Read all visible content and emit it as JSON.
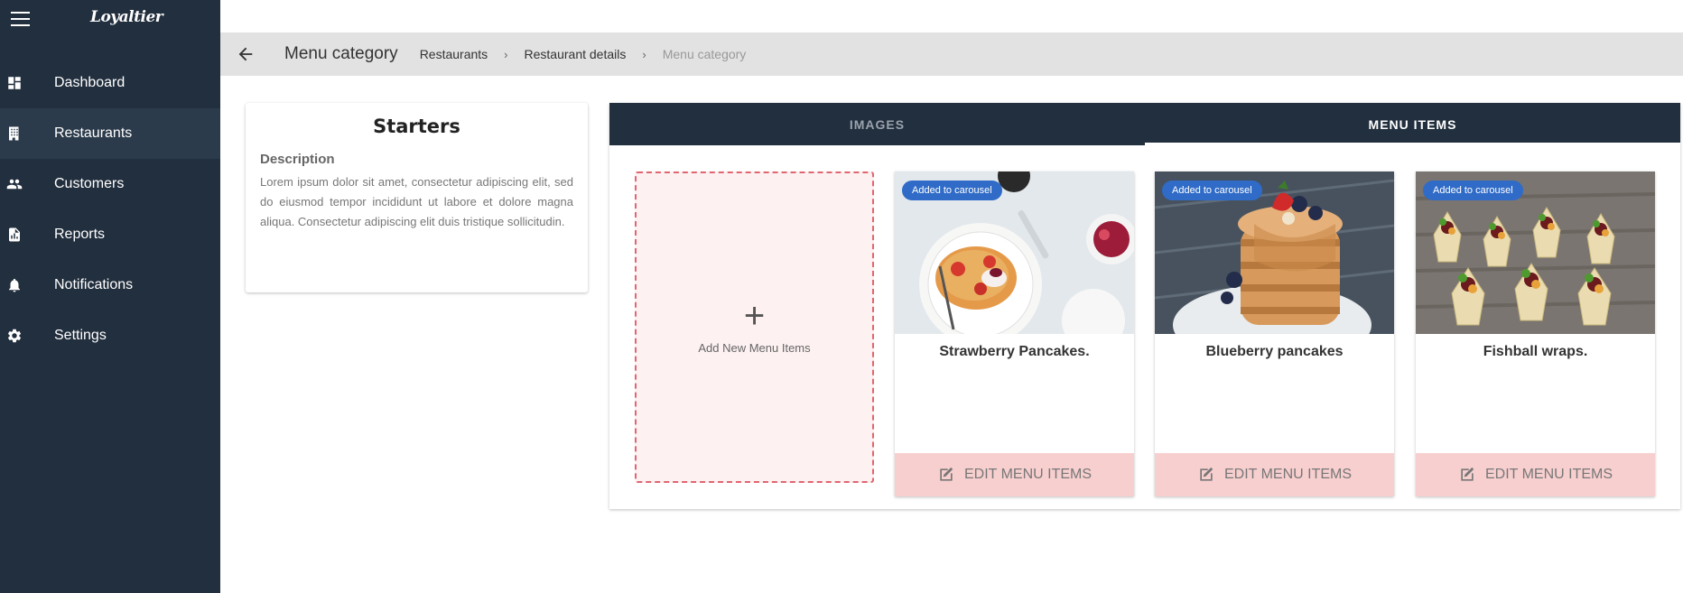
{
  "app": {
    "logo": "Loyaltier"
  },
  "sidebar": {
    "items": [
      {
        "label": "Dashboard",
        "icon": "dashboard-icon"
      },
      {
        "label": "Restaurants",
        "icon": "building-icon",
        "active": true
      },
      {
        "label": "Customers",
        "icon": "people-icon"
      },
      {
        "label": "Reports",
        "icon": "report-icon"
      },
      {
        "label": "Notifications",
        "icon": "bell-icon"
      },
      {
        "label": "Settings",
        "icon": "gear-icon"
      }
    ]
  },
  "header": {
    "title": "Menu category",
    "breadcrumbs": [
      "Restaurants",
      "Restaurant details",
      "Menu category"
    ]
  },
  "category": {
    "title": "Starters",
    "description_label": "Description",
    "description": "Lorem ipsum dolor sit amet, consectetur adipiscing elit, sed do eiusmod tempor incididunt ut labore et dolore magna aliqua. Consectetur adipiscing elit duis tristique sollicitudin."
  },
  "tabs": [
    {
      "label": "IMAGES",
      "active": false
    },
    {
      "label": "MENU ITEMS",
      "active": true
    }
  ],
  "add_item": {
    "label": "Add New Menu Items"
  },
  "menu_items": [
    {
      "name": "Strawberry Pancakes.",
      "badge": "Added to carousel",
      "edit_label": "EDIT MENU ITEMS"
    },
    {
      "name": "Blueberry pancakes",
      "badge": "Added to carousel",
      "edit_label": "EDIT MENU ITEMS"
    },
    {
      "name": "Fishball wraps.",
      "badge": "Added to carousel",
      "edit_label": "EDIT MENU ITEMS"
    }
  ],
  "colors": {
    "sidebar_bg": "#222f3e",
    "accent_badge": "#2f6bc7",
    "edit_button_bg": "#f8cfcf",
    "add_card_border": "#e06670"
  }
}
